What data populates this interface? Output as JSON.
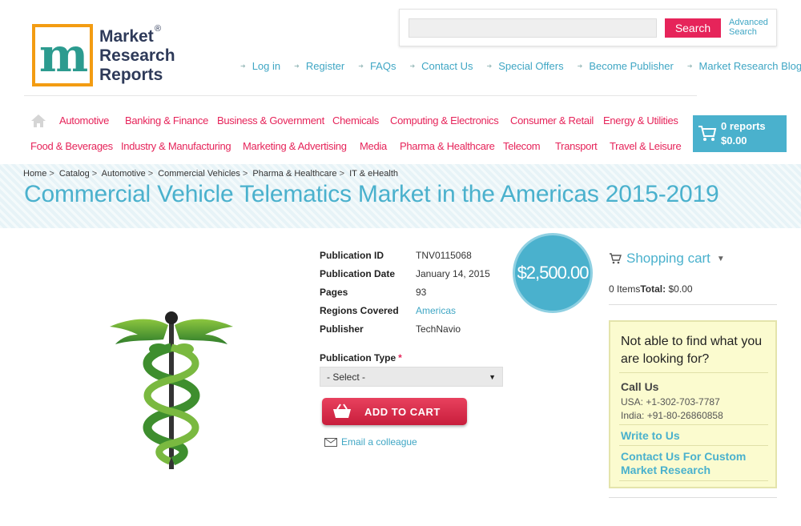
{
  "logo": {
    "line1": "Market",
    "line2": "Research",
    "line3": "Reports",
    "reg": "®",
    "mark": "m"
  },
  "search": {
    "placeholder": "",
    "button": "Search",
    "advanced_line1": "Advanced",
    "advanced_line2": "Search"
  },
  "top_links": [
    "Log in",
    "Register",
    "FAQs",
    "Contact Us",
    "Special Offers",
    "Become Publisher",
    "Market Research Blog"
  ],
  "categories_row1": [
    "Automotive",
    "Banking & Finance",
    "Business & Government",
    "Chemicals",
    "Computing & Electronics",
    "Consumer & Retail",
    "Energy & Utilities"
  ],
  "categories_row2": [
    "Food & Beverages",
    "Industry & Manufacturing",
    "Marketing & Advertising",
    "Media",
    "Pharma & Healthcare",
    "Telecom",
    "Transport",
    "Travel & Leisure"
  ],
  "cart_summary": {
    "reports": "0 reports",
    "total": "$0.00"
  },
  "breadcrumb": [
    "Home",
    "Catalog",
    "Automotive",
    "Commercial Vehicles",
    "Pharma & Healthcare",
    "IT & eHealth"
  ],
  "page_title": "Commercial Vehicle Telematics Market in the Americas 2015-2019",
  "details": [
    {
      "label": "Publication ID",
      "value": "TNV0115068"
    },
    {
      "label": "Publication Date",
      "value": "January 14, 2015"
    },
    {
      "label": "Pages",
      "value": "93"
    },
    {
      "label": "Regions Covered",
      "value": "Americas"
    },
    {
      "label": "Publisher",
      "value": "TechNavio"
    }
  ],
  "price": "$2,500.00",
  "publication_type": {
    "label": "Publication Type",
    "required_mark": "*",
    "selected": "- Select -"
  },
  "add_to_cart": "ADD TO CART",
  "email_colleague": "Email a colleague",
  "shopping_cart": {
    "title": "Shopping cart",
    "items": "0 Items",
    "total_label": "Total:",
    "total_value": "$0.00"
  },
  "help_box": {
    "question": "Not able to find what you are looking for?",
    "call_us": "Call Us",
    "usa": "USA: +1-302-703-7787",
    "india": "India: +91-80-26860858",
    "write_to_us": "Write to Us",
    "custom_research": "Contact Us For Custom Market Research"
  },
  "colors": {
    "accent_blue": "#4ab1cd",
    "accent_pink": "#e6245a",
    "link_blue": "#3fa6c4",
    "logo_orange": "#f39c12"
  }
}
